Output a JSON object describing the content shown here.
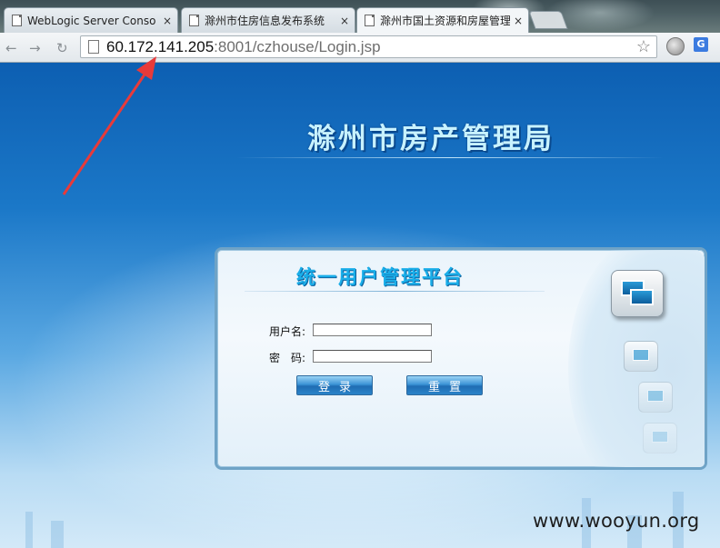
{
  "browser": {
    "tabs": [
      {
        "title": "WebLogic Server Conso",
        "close": "×",
        "active": false
      },
      {
        "title": "滁州市住房信息发布系统",
        "close": "×",
        "active": false
      },
      {
        "title": "滁州市国土资源和房屋管理",
        "close": "×",
        "active": true
      }
    ],
    "url_host": "60.172.141.205",
    "url_rest": ":8001/czhouse/Login.jsp",
    "back_icon": "arrow-left-icon",
    "forward_icon": "arrow-right-icon",
    "reload_icon": "reload-icon",
    "star_glyph": "☆"
  },
  "page": {
    "headline": "滁州市房产管理局",
    "panel_title": "统一用户管理平台",
    "username_label": "用户名:",
    "password_label": "密　码:",
    "username_value": "",
    "password_value": "",
    "login_button": "登录",
    "reset_button": "重置"
  },
  "watermark": "www.wooyun.org",
  "colors": {
    "annotation_arrow": "#e83a3a",
    "headline": "#c8f2ff",
    "panel_title": "#1aaee9"
  }
}
